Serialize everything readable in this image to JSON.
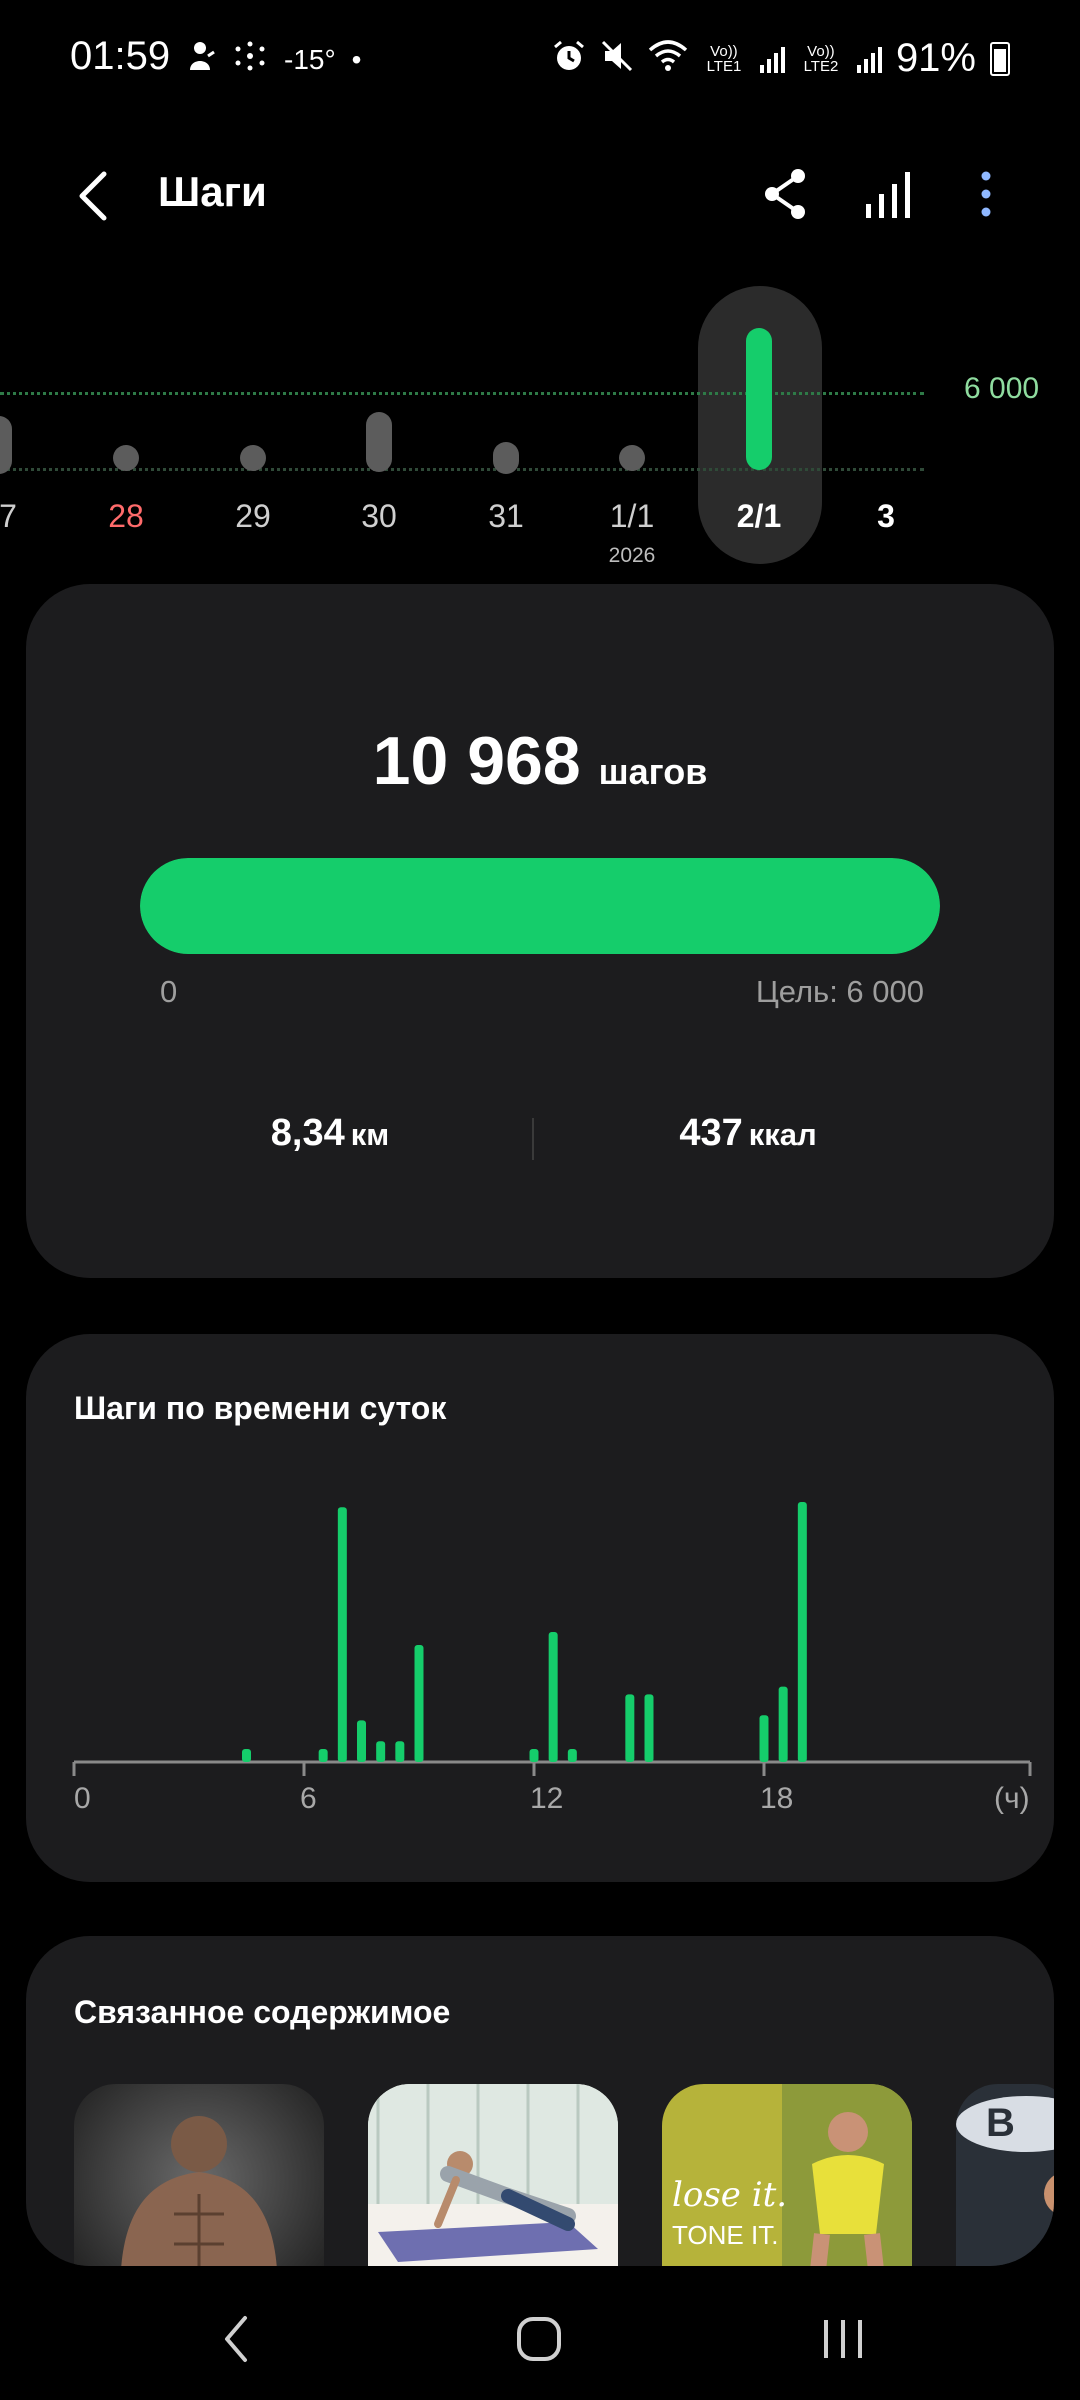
{
  "status_bar": {
    "time": "01:59",
    "temperature": "-15°",
    "battery": "91%",
    "sim1": "Vo)) LTE1",
    "sim2": "Vo)) LTE2",
    "icons": [
      "person-icon",
      "snowflake-icon",
      "dot-icon",
      "alarm-icon",
      "mute-icon",
      "wifi-icon",
      "signal-icon",
      "battery-icon"
    ]
  },
  "header": {
    "title": "Шаги",
    "icons": [
      "back-icon",
      "share-icon",
      "bar-chart-icon",
      "more-icon"
    ]
  },
  "date_strip": {
    "goal_label": "6 000",
    "days": [
      {
        "label": "7",
        "state": "partial"
      },
      {
        "label": "28",
        "state": "dot",
        "color": "red"
      },
      {
        "label": "29",
        "state": "dot"
      },
      {
        "label": "30",
        "state": "partial"
      },
      {
        "label": "31",
        "state": "dot"
      },
      {
        "label": "1/1",
        "state": "dot",
        "year": "2026"
      },
      {
        "label": "2/1",
        "state": "selected"
      },
      {
        "label": "3",
        "state": "empty"
      }
    ]
  },
  "summary": {
    "steps_value": "10 968",
    "steps_unit": "шагов",
    "progress_fraction": 1.0,
    "progress_min": "0",
    "progress_goal": "Цель: 6 000",
    "distance_value": "8,34",
    "distance_unit": "км",
    "calories_value": "437",
    "calories_unit": "ккал"
  },
  "hourly": {
    "title": "Шаги по времени суток",
    "accent_color": "#15cd6b"
  },
  "chart_data": {
    "type": "bar",
    "title": "Шаги по времени суток",
    "xlabel": "(ч)",
    "ylabel": "",
    "x_ticks": [
      "0",
      "6",
      "12",
      "18",
      "(ч)"
    ],
    "xlim": [
      0,
      24
    ],
    "ylim": [
      0,
      100
    ],
    "grid": false,
    "bars": [
      {
        "x": 4.5,
        "y": 5
      },
      {
        "x": 6.5,
        "y": 5
      },
      {
        "x": 7.0,
        "y": 98
      },
      {
        "x": 7.5,
        "y": 16
      },
      {
        "x": 8.0,
        "y": 8
      },
      {
        "x": 8.5,
        "y": 8
      },
      {
        "x": 9.0,
        "y": 45
      },
      {
        "x": 12.0,
        "y": 5
      },
      {
        "x": 12.5,
        "y": 50
      },
      {
        "x": 13.0,
        "y": 5
      },
      {
        "x": 14.5,
        "y": 26
      },
      {
        "x": 15.0,
        "y": 26
      },
      {
        "x": 18.0,
        "y": 18
      },
      {
        "x": 18.5,
        "y": 29
      },
      {
        "x": 19.0,
        "y": 100
      }
    ]
  },
  "related": {
    "title": "Связанное содержимое",
    "items": [
      {
        "name": "thumb-muscle-man",
        "text": ""
      },
      {
        "name": "thumb-pushup",
        "text": ""
      },
      {
        "name": "thumb-lose-it",
        "text": "lose it. TONE IT."
      },
      {
        "name": "thumb-partial",
        "text": ""
      }
    ]
  },
  "nav": {
    "icons": [
      "nav-back-icon",
      "nav-home-icon",
      "nav-recents-icon"
    ]
  }
}
